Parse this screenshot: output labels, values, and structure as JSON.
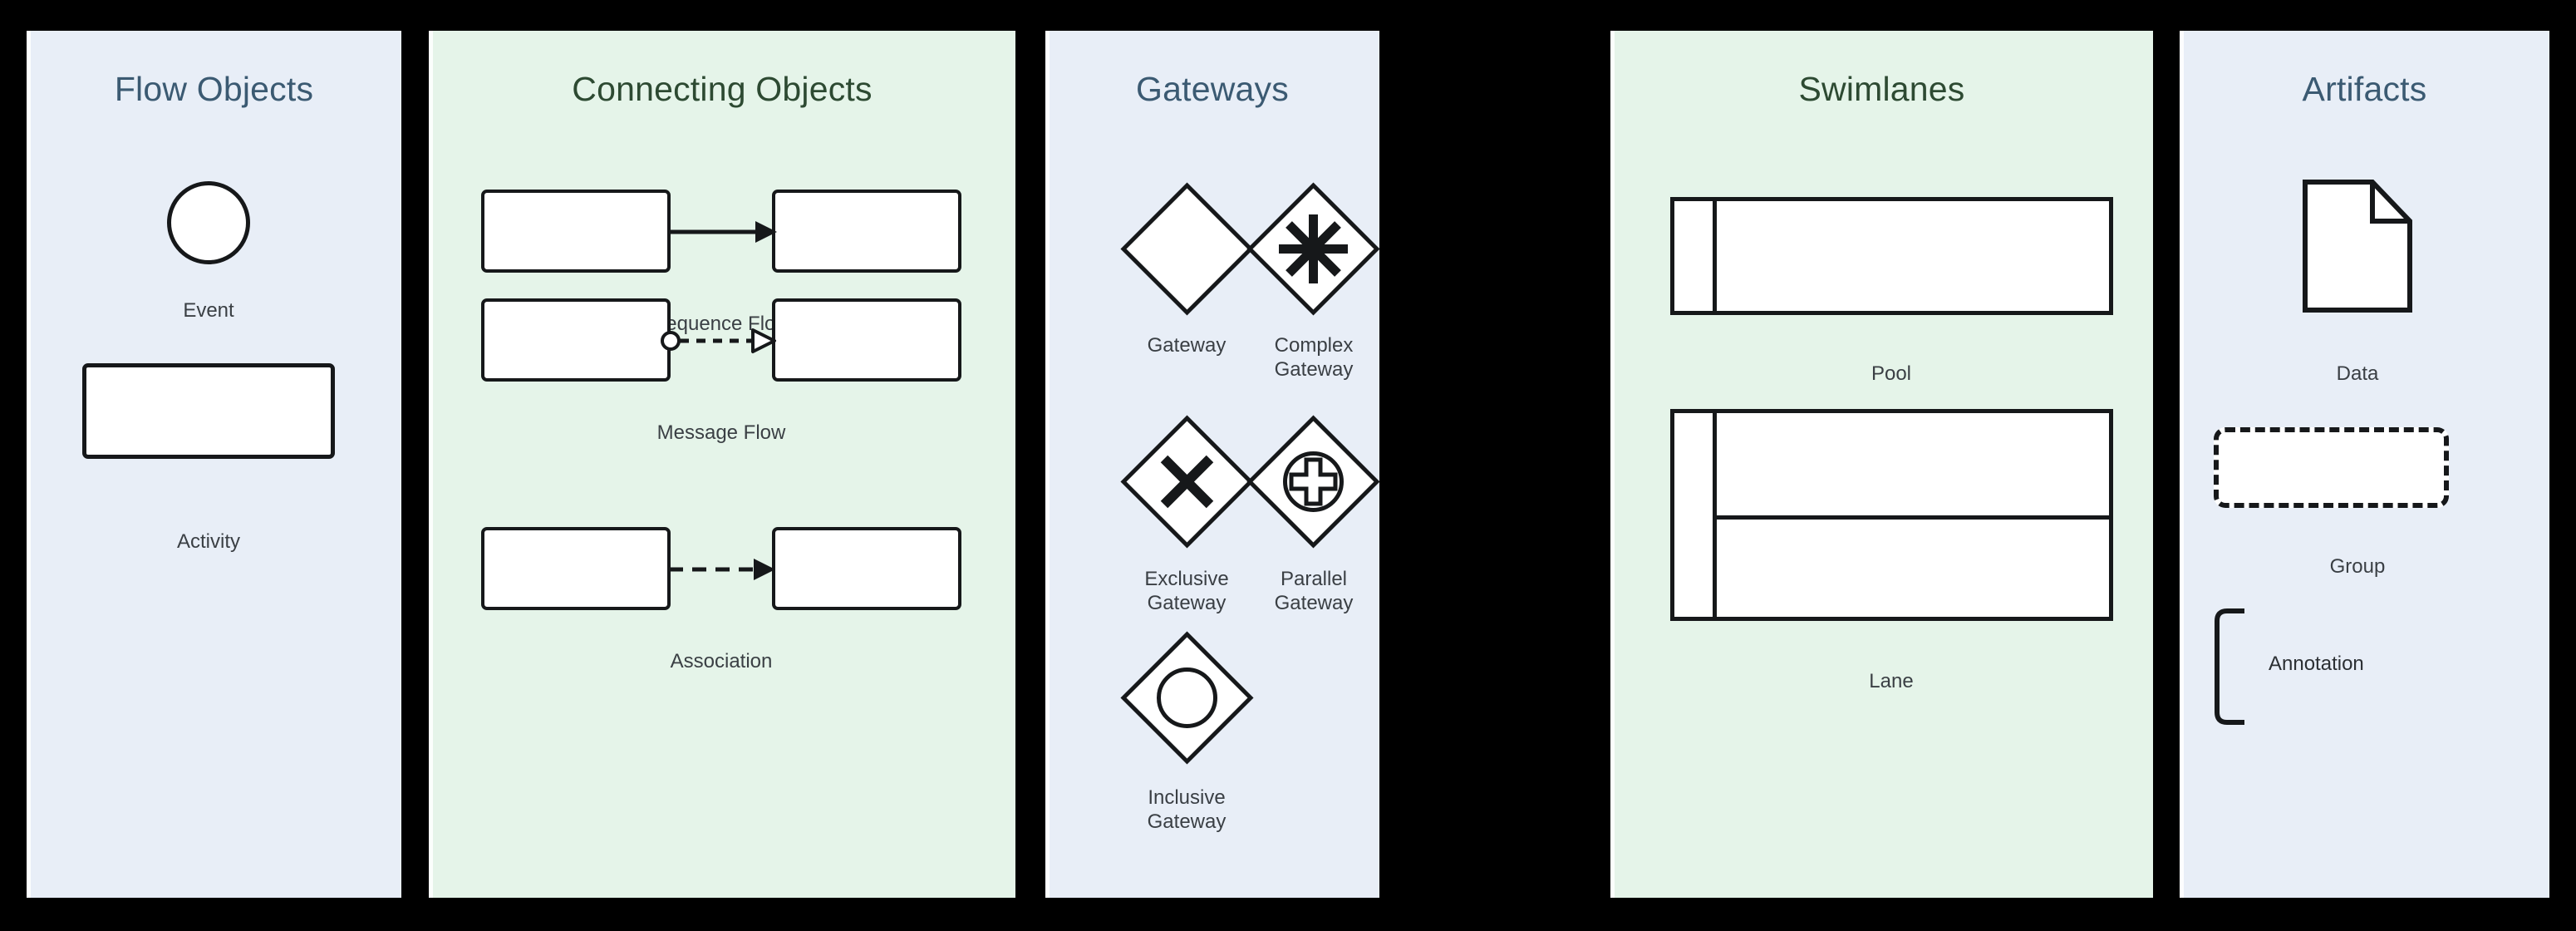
{
  "page": {
    "background": "#000000",
    "panel_blue_bg": "#e8eef7",
    "panel_green_bg": "#e5f4e9",
    "title_blue": "#3b5a72",
    "title_green": "#2d4a32",
    "stroke": "#16181a",
    "label_color": "#3a3f44",
    "shape_fill": "#ffffff"
  },
  "panels": [
    {
      "id": "flow-objects",
      "title": "Flow Objects",
      "theme": "blue",
      "items": [
        {
          "id": "event",
          "label": "Event",
          "shape": "circle"
        },
        {
          "id": "activity",
          "label": "Activity",
          "shape": "rounded-rectangle"
        }
      ]
    },
    {
      "id": "connecting-objects",
      "title": "Connecting Objects",
      "theme": "green",
      "items": [
        {
          "id": "sequence-flow",
          "label": "Sequence Flow",
          "shape": "two-boxes-solid-arrow",
          "line": "solid",
          "arrowhead": "filled-triangle",
          "source_marker": "none"
        },
        {
          "id": "message-flow",
          "label": "Message Flow",
          "shape": "two-boxes-dashed-arrow",
          "line": "dashed",
          "arrowhead": "hollow-triangle",
          "source_marker": "hollow-circle"
        },
        {
          "id": "association",
          "label": "Association",
          "shape": "two-boxes-dashed-arrow",
          "line": "dashed",
          "arrowhead": "filled-triangle",
          "source_marker": "none"
        }
      ]
    },
    {
      "id": "gateways",
      "title": "Gateways",
      "theme": "blue",
      "items": [
        {
          "id": "gateway",
          "label": "Gateway",
          "shape": "diamond",
          "marker": "none"
        },
        {
          "id": "complex-gateway",
          "label": "Complex\nGateway",
          "shape": "diamond",
          "marker": "asterisk"
        },
        {
          "id": "exclusive-gateway",
          "label": "Exclusive\nGateway",
          "shape": "diamond",
          "marker": "x-cross"
        },
        {
          "id": "parallel-gateway",
          "label": "Parallel\nGateway",
          "shape": "diamond",
          "marker": "circled-plus"
        },
        {
          "id": "inclusive-gateway",
          "label": "Inclusive\nGateway",
          "shape": "diamond",
          "marker": "circle"
        }
      ]
    },
    {
      "id": "swimlanes",
      "title": "Swimlanes",
      "theme": "green",
      "items": [
        {
          "id": "pool",
          "label": "Pool",
          "shape": "pool",
          "lanes": 1
        },
        {
          "id": "lane",
          "label": "Lane",
          "shape": "pool",
          "lanes": 2
        }
      ]
    },
    {
      "id": "artifacts",
      "title": "Artifacts",
      "theme": "blue",
      "items": [
        {
          "id": "data",
          "label": "Data",
          "shape": "document-folded-corner"
        },
        {
          "id": "group",
          "label": "Group",
          "shape": "dashed-rounded-rectangle"
        },
        {
          "id": "annotation",
          "label": "Annotation",
          "shape": "left-bracket"
        }
      ]
    }
  ]
}
